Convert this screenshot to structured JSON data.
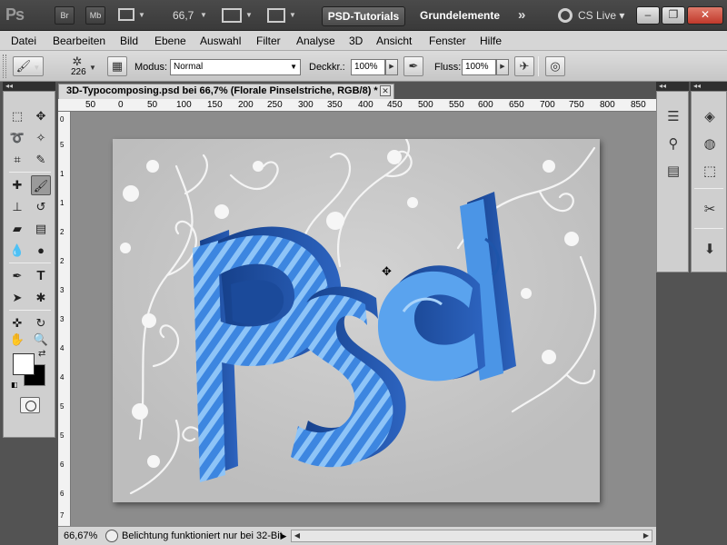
{
  "appbar": {
    "logo": "Ps",
    "bridge": "Br",
    "minibridge": "Mb",
    "zoom": "66,7",
    "workspace_active": "PSD-Tutorials",
    "workspace_other": "Grundelemente",
    "more": "»",
    "cs_live": "CS Live"
  },
  "menubar": {
    "items": [
      "Datei",
      "Bearbeiten",
      "Bild",
      "Ebene",
      "Auswahl",
      "Filter",
      "Analyse",
      "3D",
      "Ansicht",
      "Fenster",
      "Hilfe"
    ]
  },
  "options": {
    "brush_size": "226",
    "mode_label": "Modus:",
    "mode_value": "Normal",
    "opacity_label": "Deckkr.:",
    "opacity_value": "100%",
    "flow_label": "Fluss:",
    "flow_value": "100%"
  },
  "document": {
    "title": "3D-Typocomposing.psd bei 66,7% (Florale Pinselstriche, RGB/8) *",
    "ruler_h": [
      "50",
      "0",
      "50",
      "100",
      "150",
      "200",
      "250",
      "300",
      "350",
      "400",
      "450",
      "500",
      "550",
      "600",
      "650",
      "700",
      "750",
      "800",
      "850"
    ],
    "ruler_v": [
      "0",
      "5",
      "1",
      "1",
      "2",
      "2",
      "3",
      "3",
      "4",
      "4",
      "5",
      "5",
      "6",
      "6",
      "7"
    ]
  },
  "status": {
    "zoom": "66,67%",
    "message": "Belichtung funktioniert nur bei 32-Bit"
  },
  "colors": {
    "accent_blue": "#2f6fd0",
    "canvas_bg": "#c5c5c5",
    "ui_dark": "#3a3a3a"
  }
}
